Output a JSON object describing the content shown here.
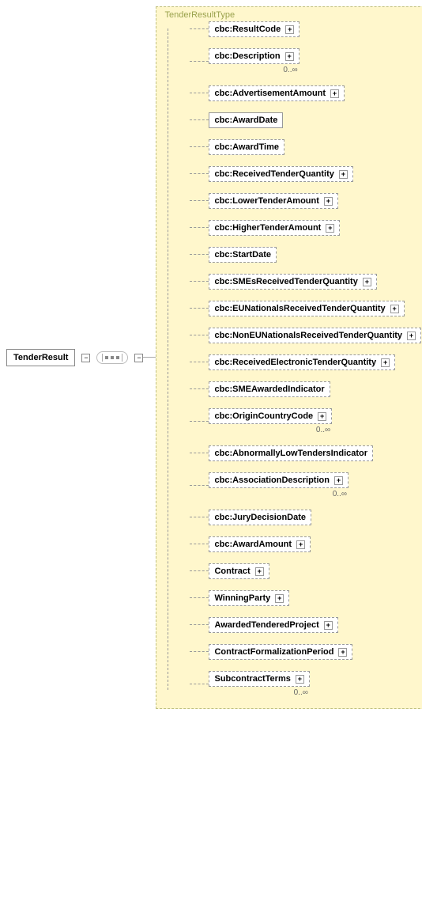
{
  "root": {
    "label": "TenderResult"
  },
  "type_label": "TenderResultType",
  "children": [
    {
      "label": "cbc:ResultCode",
      "solid": false,
      "expand": true,
      "cardinality": ""
    },
    {
      "label": "cbc:Description",
      "solid": false,
      "expand": true,
      "cardinality": "0..∞"
    },
    {
      "label": "cbc:AdvertisementAmount",
      "solid": false,
      "expand": true,
      "cardinality": ""
    },
    {
      "label": "cbc:AwardDate",
      "solid": true,
      "expand": false,
      "cardinality": ""
    },
    {
      "label": "cbc:AwardTime",
      "solid": false,
      "expand": false,
      "cardinality": ""
    },
    {
      "label": "cbc:ReceivedTenderQuantity",
      "solid": false,
      "expand": true,
      "cardinality": ""
    },
    {
      "label": "cbc:LowerTenderAmount",
      "solid": false,
      "expand": true,
      "cardinality": ""
    },
    {
      "label": "cbc:HigherTenderAmount",
      "solid": false,
      "expand": true,
      "cardinality": ""
    },
    {
      "label": "cbc:StartDate",
      "solid": false,
      "expand": false,
      "cardinality": ""
    },
    {
      "label": "cbc:SMEsReceivedTenderQuantity",
      "solid": false,
      "expand": true,
      "cardinality": ""
    },
    {
      "label": "cbc:EUNationalsReceivedTenderQuantity",
      "solid": false,
      "expand": true,
      "cardinality": ""
    },
    {
      "label": "cbc:NonEUNationalsReceivedTenderQuantity",
      "solid": false,
      "expand": true,
      "cardinality": ""
    },
    {
      "label": "cbc:ReceivedElectronicTenderQuantity",
      "solid": false,
      "expand": true,
      "cardinality": ""
    },
    {
      "label": "cbc:SMEAwardedIndicator",
      "solid": false,
      "expand": false,
      "cardinality": ""
    },
    {
      "label": "cbc:OriginCountryCode",
      "solid": false,
      "expand": true,
      "cardinality": "0..∞"
    },
    {
      "label": "cbc:AbnormallyLowTendersIndicator",
      "solid": false,
      "expand": false,
      "cardinality": ""
    },
    {
      "label": "cbc:AssociationDescription",
      "solid": false,
      "expand": true,
      "cardinality": "0..∞"
    },
    {
      "label": "cbc:JuryDecisionDate",
      "solid": false,
      "expand": false,
      "cardinality": ""
    },
    {
      "label": "cbc:AwardAmount",
      "solid": false,
      "expand": true,
      "cardinality": ""
    },
    {
      "label": "Contract",
      "solid": false,
      "expand": true,
      "cardinality": ""
    },
    {
      "label": "WinningParty",
      "solid": false,
      "expand": true,
      "cardinality": ""
    },
    {
      "label": "AwardedTenderedProject",
      "solid": false,
      "expand": true,
      "cardinality": ""
    },
    {
      "label": "ContractFormalizationPeriod",
      "solid": false,
      "expand": true,
      "cardinality": ""
    },
    {
      "label": "SubcontractTerms",
      "solid": false,
      "expand": true,
      "cardinality": "0..∞"
    }
  ]
}
